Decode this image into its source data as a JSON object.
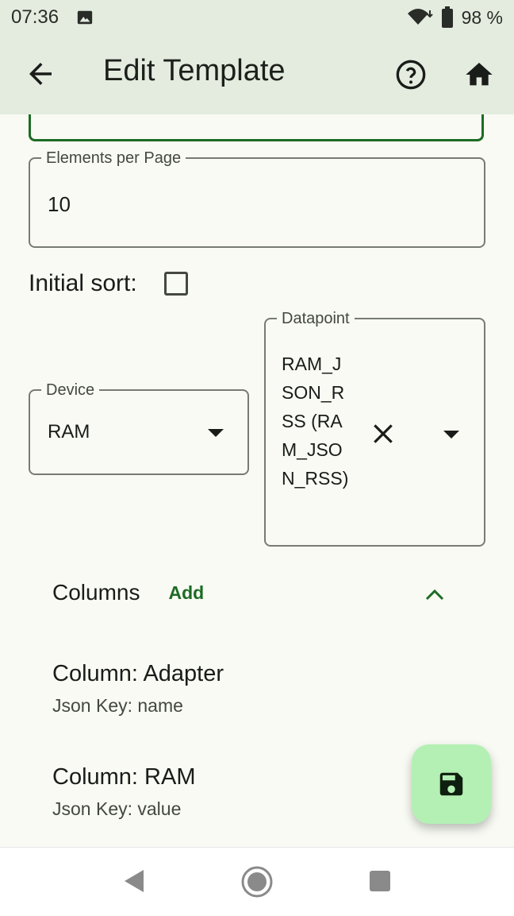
{
  "status_bar": {
    "time": "07:36",
    "battery": "98 %"
  },
  "app_bar": {
    "title": "Edit Template"
  },
  "form": {
    "elements_per_page": {
      "label": "Elements per Page",
      "value": "10"
    },
    "initial_sort": {
      "label": "Initial sort:",
      "checked": false
    },
    "device": {
      "label": "Device",
      "value": "RAM"
    },
    "datapoint": {
      "label": "Datapoint",
      "value": "RAM_JSON_RSS (RAM_JSON_RSS)"
    }
  },
  "columns": {
    "title": "Columns",
    "add_label": "Add",
    "items": [
      {
        "title": "Column: Adapter",
        "subtitle": "Json Key: name"
      },
      {
        "title": "Column: RAM",
        "subtitle": "Json Key: value"
      }
    ]
  },
  "colors": {
    "accent": "#1d6b24",
    "fab": "#b4f0b4",
    "appbar": "#e3ecdf"
  }
}
